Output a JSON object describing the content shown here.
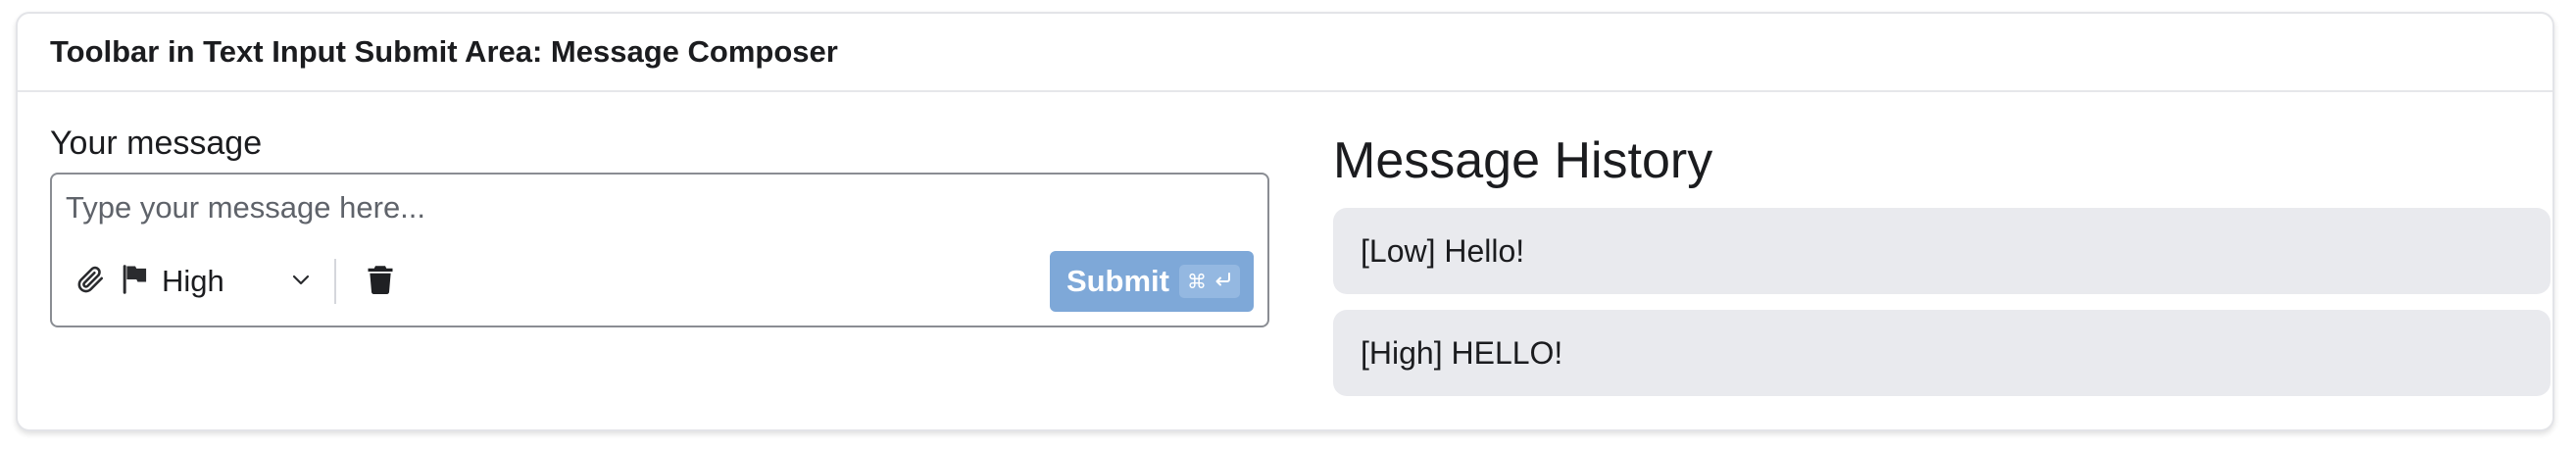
{
  "card": {
    "title": "Toolbar in Text Input Submit Area: Message Composer"
  },
  "composer": {
    "label": "Your message",
    "placeholder": "Type your message here...",
    "value": "",
    "toolbar": {
      "attach_icon": "paperclip-icon",
      "priority_icon": "flag-icon",
      "priority_value": "High",
      "priority_chevron_icon": "chevron-down-icon",
      "clear_icon": "trash-icon",
      "submit_label": "Submit",
      "submit_shortcut_icons": [
        "command-icon",
        "enter-icon"
      ]
    },
    "submit_color": "#7ea8d8"
  },
  "history": {
    "title": "Message History",
    "items": [
      {
        "text": "[Low] Hello!"
      },
      {
        "text": "[High] HELLO!"
      }
    ],
    "item_background": "#e9eaee"
  }
}
